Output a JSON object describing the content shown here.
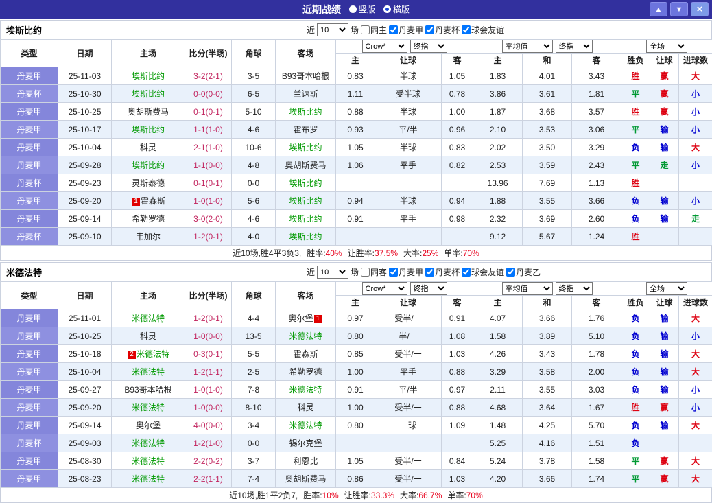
{
  "titlebar": {
    "title": "近期战绩",
    "layout_vertical": "竖版",
    "layout_horizontal": "横版",
    "selected_layout": "横版",
    "up_button": "▲",
    "down_button": "▼",
    "close_button": "×"
  },
  "colors": {
    "accent": "#32309e",
    "score": "#c2255f",
    "focus_team": "#009900",
    "stat_value": "#e8001c",
    "type_cell": "#8486db",
    "alt_row": "#e9f1fb"
  },
  "value_colors": {
    "胜": "#dd0010",
    "平": "#009933",
    "负": "#0000d0",
    "赢": "#dd0010",
    "输": "#0000d0",
    "走": "#009933",
    "大": "#dd0010",
    "小": "#0000d0"
  },
  "columns": {
    "type": "类型",
    "date": "日期",
    "home": "主场",
    "score": "比分(半场)",
    "corner": "角球",
    "away": "客场",
    "asian_home": "主",
    "asian_handicap": "让球",
    "asian_away": "客",
    "euro_home": "主",
    "euro_draw": "和",
    "euro_away": "客",
    "result": "胜负",
    "handicap_result": "让球",
    "goals": "进球数"
  },
  "selects": {
    "recent_count": "10",
    "asian_company": "Crow*",
    "asian_stage": "终指",
    "euro_company": "平均值",
    "euro_stage": "终指",
    "scope": "全场"
  },
  "filter_labels": {
    "near": "近",
    "games": "场"
  },
  "sections": [
    {
      "team": "埃斯比约",
      "filters": [
        {
          "label": "同主",
          "checked": false
        },
        {
          "label": "丹麦甲",
          "checked": true
        },
        {
          "label": "丹麦杯",
          "checked": true
        },
        {
          "label": "球会友谊",
          "checked": true
        }
      ],
      "rows": [
        {
          "league": "丹麦甲",
          "date": "25-11-03",
          "home": "埃斯比约",
          "home_focus": true,
          "score": "3-2(2-1)",
          "corner": "3-5",
          "away": "B93哥本哈根",
          "asian": [
            "0.83",
            "半球",
            "1.05"
          ],
          "euro": [
            "1.83",
            "4.01",
            "3.43"
          ],
          "results": [
            "胜",
            "赢",
            "大"
          ]
        },
        {
          "league": "丹麦杯",
          "date": "25-10-30",
          "home": "埃斯比约",
          "home_focus": true,
          "score": "0-0(0-0)",
          "corner": "6-5",
          "away": "兰讷斯",
          "asian": [
            "1.11",
            "受半球",
            "0.78"
          ],
          "euro": [
            "3.86",
            "3.61",
            "1.81"
          ],
          "results": [
            "平",
            "赢",
            "小"
          ]
        },
        {
          "league": "丹麦甲",
          "date": "25-10-25",
          "home": "奥胡斯费马",
          "score": "0-1(0-1)",
          "corner": "5-10",
          "away": "埃斯比约",
          "away_focus": true,
          "asian": [
            "0.88",
            "半球",
            "1.00"
          ],
          "euro": [
            "1.87",
            "3.68",
            "3.57"
          ],
          "results": [
            "胜",
            "赢",
            "小"
          ]
        },
        {
          "league": "丹麦甲",
          "date": "25-10-17",
          "home": "埃斯比约",
          "home_focus": true,
          "score": "1-1(1-0)",
          "corner": "4-6",
          "away": "霍布罗",
          "asian": [
            "0.93",
            "平/半",
            "0.96"
          ],
          "euro": [
            "2.10",
            "3.53",
            "3.06"
          ],
          "results": [
            "平",
            "输",
            "小"
          ]
        },
        {
          "league": "丹麦甲",
          "date": "25-10-04",
          "home": "科灵",
          "score": "2-1(1-0)",
          "corner": "10-6",
          "away": "埃斯比约",
          "away_focus": true,
          "asian": [
            "1.05",
            "半球",
            "0.83"
          ],
          "euro": [
            "2.02",
            "3.50",
            "3.29"
          ],
          "results": [
            "负",
            "输",
            "大"
          ]
        },
        {
          "league": "丹麦甲",
          "date": "25-09-28",
          "home": "埃斯比约",
          "home_focus": true,
          "score": "1-1(0-0)",
          "corner": "4-8",
          "away": "奥胡斯费马",
          "asian": [
            "1.06",
            "平手",
            "0.82"
          ],
          "euro": [
            "2.53",
            "3.59",
            "2.43"
          ],
          "results": [
            "平",
            "走",
            "小"
          ]
        },
        {
          "league": "丹麦杯",
          "date": "25-09-23",
          "home": "灵斯泰德",
          "score": "0-1(0-1)",
          "corner": "0-0",
          "away": "埃斯比约",
          "away_focus": true,
          "asian": [
            "",
            "",
            ""
          ],
          "euro": [
            "13.96",
            "7.69",
            "1.13"
          ],
          "results": [
            "胜",
            "",
            ""
          ]
        },
        {
          "league": "丹麦甲",
          "date": "25-09-20",
          "home": "霍森斯",
          "home_badge": "1",
          "score": "1-0(1-0)",
          "corner": "5-6",
          "away": "埃斯比约",
          "away_focus": true,
          "asian": [
            "0.94",
            "半球",
            "0.94"
          ],
          "euro": [
            "1.88",
            "3.55",
            "3.66"
          ],
          "results": [
            "负",
            "输",
            "小"
          ]
        },
        {
          "league": "丹麦甲",
          "date": "25-09-14",
          "home": "希勒罗德",
          "score": "3-0(2-0)",
          "corner": "4-6",
          "away": "埃斯比约",
          "away_focus": true,
          "asian": [
            "0.91",
            "平手",
            "0.98"
          ],
          "euro": [
            "2.32",
            "3.69",
            "2.60"
          ],
          "results": [
            "负",
            "输",
            "走"
          ]
        },
        {
          "league": "丹麦杯",
          "date": "25-09-10",
          "home": "韦加尔",
          "score": "1-2(0-1)",
          "corner": "4-0",
          "away": "埃斯比约",
          "away_focus": true,
          "asian": [
            "",
            "",
            ""
          ],
          "euro": [
            "9.12",
            "5.67",
            "1.24"
          ],
          "results": [
            "胜",
            "",
            ""
          ]
        }
      ],
      "summary": {
        "prefix": "近10场,胜4平3负3,",
        "stats": [
          {
            "label": "胜率:",
            "value": "40%"
          },
          {
            "label": "让胜率:",
            "value": "37.5%"
          },
          {
            "label": "大率:",
            "value": "25%"
          },
          {
            "label": "单率:",
            "value": "70%"
          }
        ]
      }
    },
    {
      "team": "米德法特",
      "filters": [
        {
          "label": "同客",
          "checked": false
        },
        {
          "label": "丹麦甲",
          "checked": true
        },
        {
          "label": "丹麦杯",
          "checked": true
        },
        {
          "label": "球会友谊",
          "checked": true
        },
        {
          "label": "丹麦乙",
          "checked": true
        }
      ],
      "rows": [
        {
          "league": "丹麦甲",
          "date": "25-11-01",
          "home": "米德法特",
          "home_focus": true,
          "score": "1-2(0-1)",
          "corner": "4-4",
          "away": "奥尔堡",
          "away_badge": "1",
          "asian": [
            "0.97",
            "受半/一",
            "0.91"
          ],
          "euro": [
            "4.07",
            "3.66",
            "1.76"
          ],
          "results": [
            "负",
            "输",
            "大"
          ]
        },
        {
          "league": "丹麦甲",
          "date": "25-10-25",
          "home": "科灵",
          "score": "1-0(0-0)",
          "corner": "13-5",
          "away": "米德法特",
          "away_focus": true,
          "asian": [
            "0.80",
            "半/一",
            "1.08"
          ],
          "euro": [
            "1.58",
            "3.89",
            "5.10"
          ],
          "results": [
            "负",
            "输",
            "小"
          ]
        },
        {
          "league": "丹麦甲",
          "date": "25-10-18",
          "home": "米德法特",
          "home_focus": true,
          "home_badge": "2",
          "score": "0-3(0-1)",
          "corner": "5-5",
          "away": "霍森斯",
          "asian": [
            "0.85",
            "受半/一",
            "1.03"
          ],
          "euro": [
            "4.26",
            "3.43",
            "1.78"
          ],
          "results": [
            "负",
            "输",
            "大"
          ]
        },
        {
          "league": "丹麦甲",
          "date": "25-10-04",
          "home": "米德法特",
          "home_focus": true,
          "score": "1-2(1-1)",
          "corner": "2-5",
          "away": "希勒罗德",
          "asian": [
            "1.00",
            "平手",
            "0.88"
          ],
          "euro": [
            "3.29",
            "3.58",
            "2.00"
          ],
          "results": [
            "负",
            "输",
            "大"
          ]
        },
        {
          "league": "丹麦甲",
          "date": "25-09-27",
          "home": "B93哥本哈根",
          "score": "1-0(1-0)",
          "corner": "7-8",
          "away": "米德法特",
          "away_focus": true,
          "asian": [
            "0.91",
            "平/半",
            "0.97"
          ],
          "euro": [
            "2.11",
            "3.55",
            "3.03"
          ],
          "results": [
            "负",
            "输",
            "小"
          ]
        },
        {
          "league": "丹麦甲",
          "date": "25-09-20",
          "home": "米德法特",
          "home_focus": true,
          "score": "1-0(0-0)",
          "corner": "8-10",
          "away": "科灵",
          "asian": [
            "1.00",
            "受半/一",
            "0.88"
          ],
          "euro": [
            "4.68",
            "3.64",
            "1.67"
          ],
          "results": [
            "胜",
            "赢",
            "小"
          ]
        },
        {
          "league": "丹麦甲",
          "date": "25-09-14",
          "home": "奥尔堡",
          "score": "4-0(0-0)",
          "corner": "3-4",
          "away": "米德法特",
          "away_focus": true,
          "asian": [
            "0.80",
            "一球",
            "1.09"
          ],
          "euro": [
            "1.48",
            "4.25",
            "5.70"
          ],
          "results": [
            "负",
            "输",
            "大"
          ]
        },
        {
          "league": "丹麦杯",
          "date": "25-09-03",
          "home": "米德法特",
          "home_focus": true,
          "score": "1-2(1-0)",
          "corner": "0-0",
          "away": "锡尔克堡",
          "asian": [
            "",
            "",
            ""
          ],
          "euro": [
            "5.25",
            "4.16",
            "1.51"
          ],
          "results": [
            "负",
            "",
            ""
          ]
        },
        {
          "league": "丹麦甲",
          "date": "25-08-30",
          "home": "米德法特",
          "home_focus": true,
          "score": "2-2(0-2)",
          "corner": "3-7",
          "away": "利恩比",
          "asian": [
            "1.05",
            "受半/一",
            "0.84"
          ],
          "euro": [
            "5.24",
            "3.78",
            "1.58"
          ],
          "results": [
            "平",
            "赢",
            "大"
          ]
        },
        {
          "league": "丹麦甲",
          "date": "25-08-23",
          "home": "米德法特",
          "home_focus": true,
          "score": "2-2(1-1)",
          "corner": "7-4",
          "away": "奥胡斯费马",
          "asian": [
            "0.86",
            "受半/一",
            "1.03"
          ],
          "euro": [
            "4.20",
            "3.66",
            "1.74"
          ],
          "results": [
            "平",
            "赢",
            "大"
          ]
        }
      ],
      "summary": {
        "prefix": "近10场,胜1平2负7,",
        "stats": [
          {
            "label": "胜率:",
            "value": "10%"
          },
          {
            "label": "让胜率:",
            "value": "33.3%"
          },
          {
            "label": "大率:",
            "value": "66.7%"
          },
          {
            "label": "单率:",
            "value": "70%"
          }
        ]
      }
    }
  ]
}
